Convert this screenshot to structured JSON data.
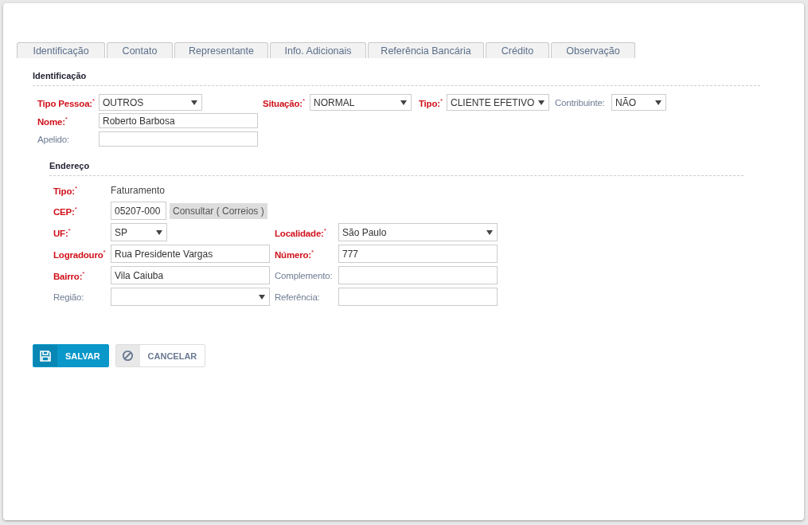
{
  "tabs": [
    {
      "label": "Identificação"
    },
    {
      "label": "Contato"
    },
    {
      "label": "Representante"
    },
    {
      "label": "Info. Adicionais"
    },
    {
      "label": "Referência Bancária"
    },
    {
      "label": "Crédito"
    },
    {
      "label": "Observação"
    }
  ],
  "identificacao": {
    "title": "Identificação",
    "row1": [
      {
        "label": "Tipo Pessoa:$^{*}$",
        "required": true,
        "kind": "select",
        "value": "OUTROS"
      },
      {
        "label": "Situação:$^{*}$",
        "required": true,
        "kind": "select",
        "value": "NORMAL"
      },
      {
        "label": "Tipo:$^{*}$",
        "required": true,
        "kind": "select",
        "value": "CLIENTE EFETIVO"
      },
      {
        "label": "Contribuinte:",
        "required": false,
        "kind": "select",
        "value": "NÃO"
      }
    ],
    "rows": [
      {
        "label": "Nome:$^{*}$",
        "required": true,
        "kind": "input",
        "value": "Roberto Barbosa"
      },
      {
        "label": "Apelido:",
        "required": false,
        "kind": "input"
      }
    ]
  },
  "endereco": {
    "title": "Endereço",
    "tipo": {
      "label": "Tipo:$^{*}$",
      "required": true,
      "kind": "text",
      "value": "Faturamento"
    },
    "cep": {
      "label": "CEP:$^{*}$",
      "required": true,
      "kind": "input",
      "value": "05207-000",
      "button": "Consultar ( Correios )"
    },
    "rows": [
      [
        {
          "label": "UF:$^{*}$",
          "required": true,
          "kind": "select",
          "value": "SP"
        },
        {
          "label": "Localidade:$^{*}$",
          "required": true,
          "kind": "select",
          "value": "São Paulo"
        }
      ],
      [
        {
          "label": "Logradouro$^{*}$",
          "required": true,
          "kind": "input",
          "value": "Rua Presidente Vargas"
        },
        {
          "label": "Número:$^{*}$",
          "required": true,
          "kind": "input",
          "value": "777"
        }
      ],
      [
        {
          "label": "Bairro:$^{*}$",
          "required": true,
          "kind": "input",
          "value": "Vila Caiuba"
        },
        {
          "label": "Complemento:",
          "required": false,
          "kind": "input"
        }
      ],
      [
        {
          "label": "Região:",
          "required": false,
          "kind": "select"
        },
        {
          "label": "Referência:",
          "required": false,
          "kind": "input"
        }
      ]
    ]
  },
  "buttons": [
    {
      "label": "SALVAR",
      "kind": "primary"
    },
    {
      "label": "CANCELAR",
      "kind": "secondary"
    }
  ]
}
